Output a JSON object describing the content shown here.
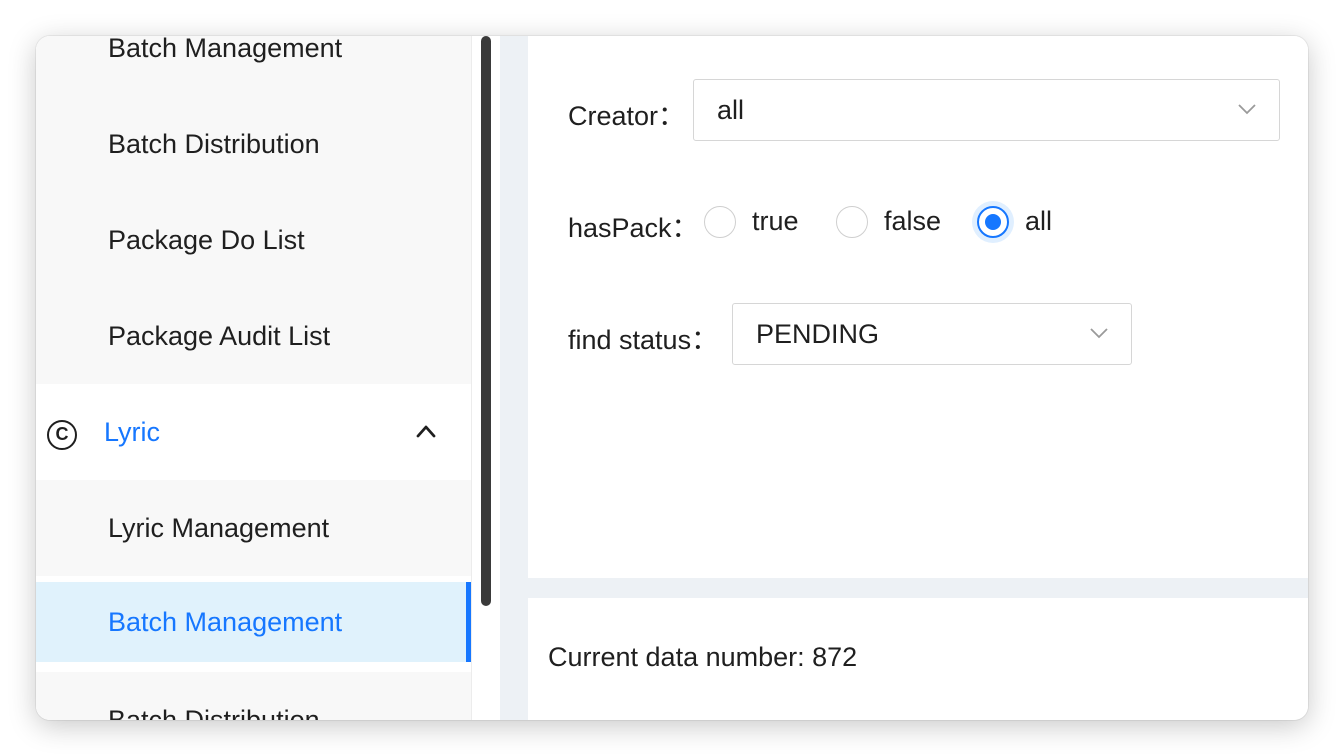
{
  "sidebar": {
    "items_top": [
      {
        "label": "Batch Management"
      },
      {
        "label": "Batch Distribution"
      },
      {
        "label": "Package Do List"
      },
      {
        "label": "Package Audit List"
      }
    ],
    "group": {
      "label": "Lyric",
      "icon": "copyright-icon",
      "expanded": true
    },
    "items_lyric": [
      {
        "label": "Lyric Management"
      },
      {
        "label": "Batch Management",
        "selected": true
      },
      {
        "label": "Batch Distribution"
      }
    ]
  },
  "filters": {
    "creator": {
      "label": "Creator：",
      "value": "all"
    },
    "has_pack": {
      "label": "hasPack：",
      "options": [
        "true",
        "false",
        "all"
      ],
      "selected": "all"
    },
    "find_status": {
      "label": "find status：",
      "value": "PENDING"
    }
  },
  "results": {
    "count_text": "Current data number: 872"
  },
  "colors": {
    "accent": "#1677ff",
    "selected_bg": "#e0f2fc",
    "band": "#edf1f5"
  }
}
